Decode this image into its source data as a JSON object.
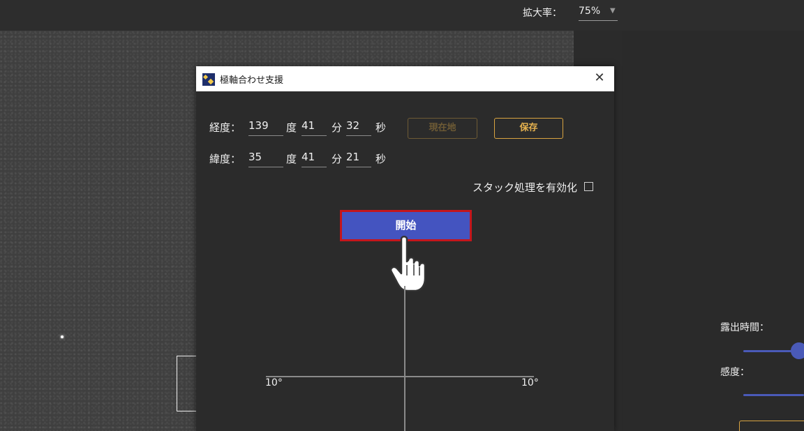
{
  "toolbar": {
    "zoom_label": "拡大率：",
    "zoom_value": "75%"
  },
  "right_panel": {
    "exposure_label": "露出時間：",
    "sensitivity_label": "感度："
  },
  "dialog": {
    "title": "極軸合わせ支援",
    "longitude": {
      "label": "経度：",
      "degrees": "139",
      "minutes": "41",
      "seconds": "32"
    },
    "latitude": {
      "label": "緯度：",
      "degrees": "35",
      "minutes": "41",
      "seconds": "21"
    },
    "units": {
      "degree": "度",
      "minute": "分",
      "second": "秒"
    },
    "current_location_label": "現在地",
    "save_label": "保存",
    "stack_label": "スタック処理を有効化",
    "stack_enabled": false,
    "start_label": "開始",
    "axis_left_label": "10°",
    "axis_right_label": "10°"
  },
  "colors": {
    "accent_blue": "#4454c0",
    "highlight_red": "#c4161c",
    "gold": "#d9a441"
  }
}
